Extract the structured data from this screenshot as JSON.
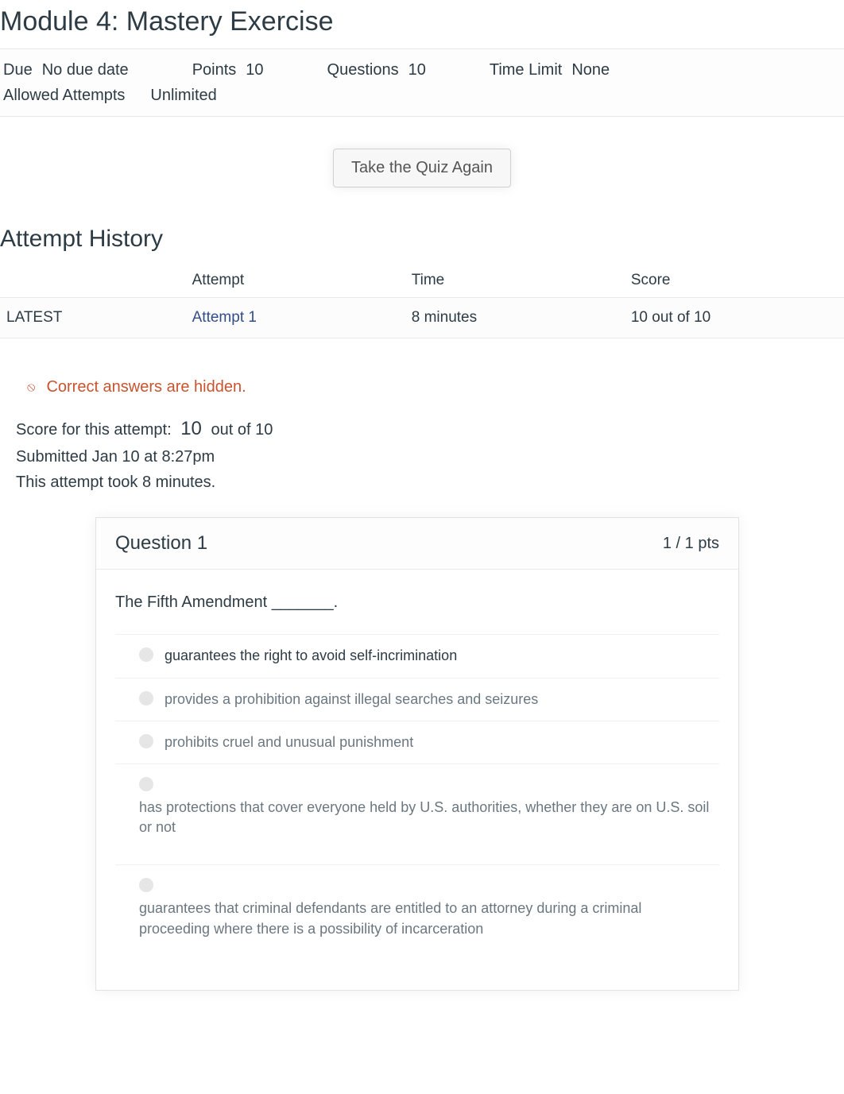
{
  "title": "Module 4: Mastery Exercise",
  "meta": {
    "due_label": "Due",
    "due_value": "No due date",
    "points_label": "Points",
    "points_value": "10",
    "questions_label": "Questions",
    "questions_value": "10",
    "timelimit_label": "Time Limit",
    "timelimit_value": "None",
    "allowed_label": "Allowed Attempts",
    "allowed_value": "Unlimited"
  },
  "take_button": "Take the Quiz Again",
  "history_title": "Attempt History",
  "history_headers": {
    "blank": "",
    "attempt": "Attempt",
    "time": "Time",
    "score": "Score"
  },
  "history_row": {
    "latest": "LATEST",
    "attempt": "Attempt 1",
    "time": "8 minutes",
    "score": "10 out of 10"
  },
  "hidden_note": "Correct answers are hidden.",
  "score_line_prefix": "Score for this attempt:",
  "score_line_value": "10",
  "score_line_suffix": "out of 10",
  "submitted_line": "Submitted Jan 10 at 8:27pm",
  "duration_line": "This attempt took 8 minutes.",
  "question": {
    "heading": "Question 1",
    "points": "1 / 1 pts",
    "prompt": "The Fifth Amendment _______.",
    "answers": [
      "guarantees the right to avoid self-incrimination",
      "provides a prohibition against illegal searches and seizures",
      "prohibits cruel and unusual punishment",
      "has protections that cover everyone held by U.S. authorities, whether they are on U.S. soil or not",
      "guarantees that criminal defendants are entitled to an attorney during a criminal proceeding where there is a possibility of incarceration"
    ]
  }
}
